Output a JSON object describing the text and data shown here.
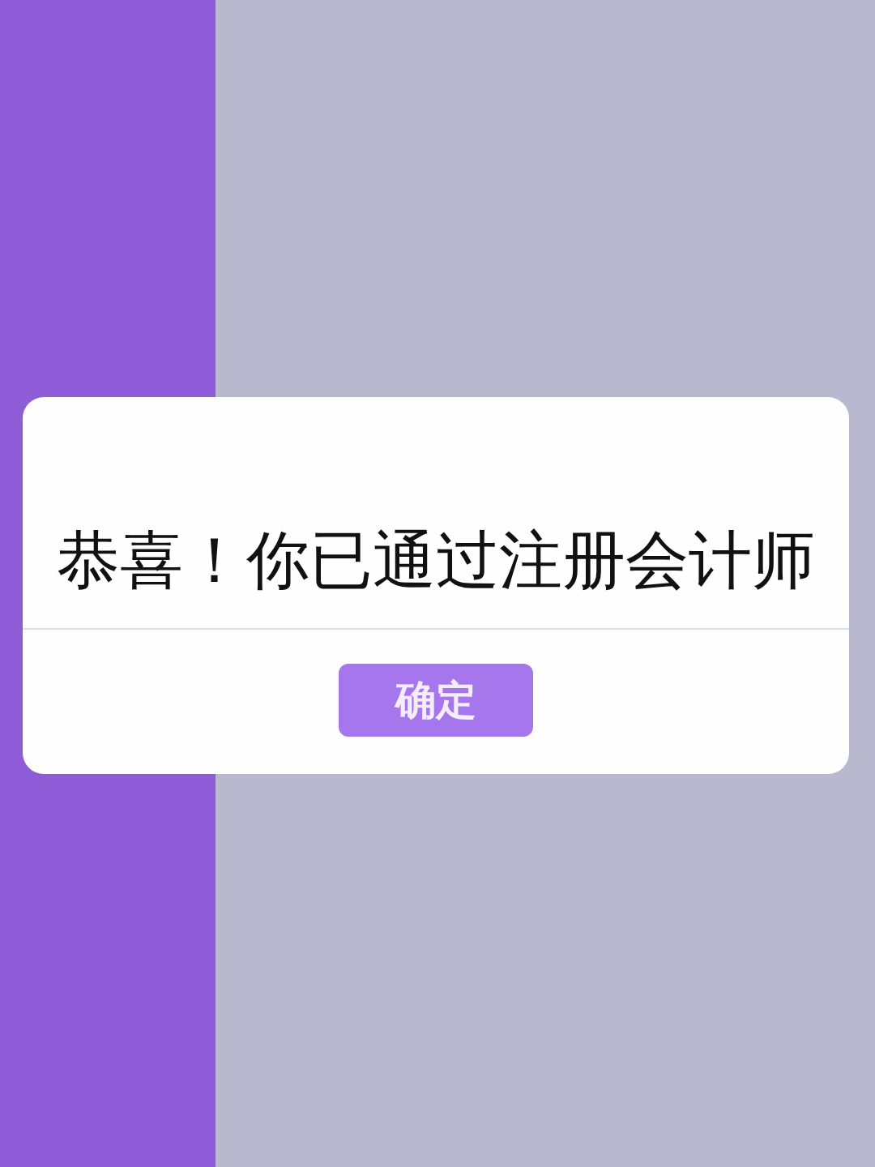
{
  "dialog": {
    "message": "恭喜！你已通过注册会计师",
    "confirm_button": "确定"
  }
}
